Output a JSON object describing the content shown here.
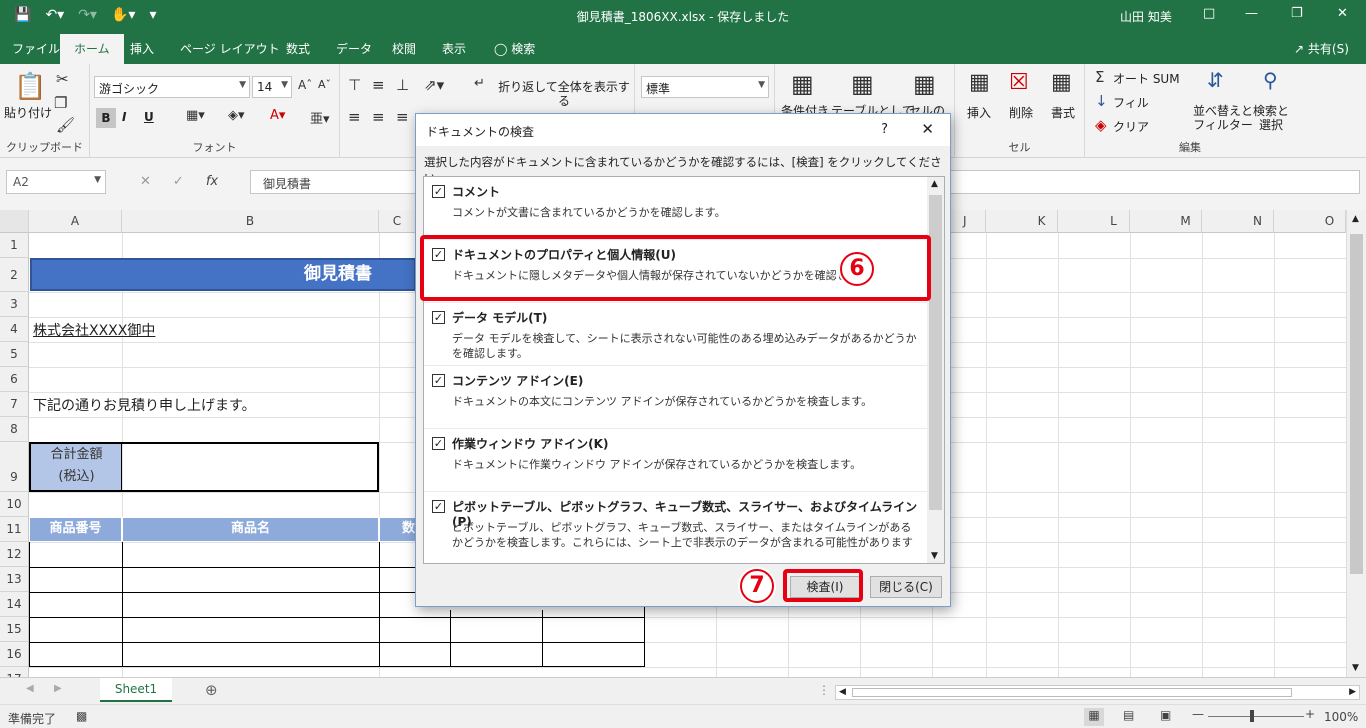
{
  "window": {
    "title": "御見積書_1806XX.xlsx  -  保存しました",
    "user": "山田 知美"
  },
  "tabs": [
    "ファイル",
    "ホーム",
    "挿入",
    "ページ レイアウト",
    "数式",
    "データ",
    "校閲",
    "表示",
    "検索"
  ],
  "tabs_active": "ホーム",
  "share_label": "共有(S)",
  "ribbon": {
    "clipboard": {
      "paste": "貼り付け",
      "group": "クリップボード"
    },
    "font": {
      "name": "游ゴシック",
      "size": "14",
      "bold": "B",
      "italic": "I",
      "underline": "U",
      "group": "フォント"
    },
    "alignment": {
      "wrap": "折り返して全体を表示する"
    },
    "number": {
      "format": "標準"
    },
    "styles": {
      "conditional": "条件付き",
      "table": "テーブルとして",
      "cell": "セルの"
    },
    "cells": {
      "insert": "挿入",
      "delete": "削除",
      "format": "書式",
      "group": "セル"
    },
    "editing": {
      "autosum": "オート SUM",
      "fill": "フィル",
      "clear": "クリア",
      "sort": "並べ替えと\nフィルター",
      "find": "検索と\n選択",
      "group": "編集"
    }
  },
  "formula_bar": {
    "namebox": "A2",
    "content": "御見積書"
  },
  "columns": [
    "A",
    "B",
    "C",
    "J",
    "K",
    "L",
    "M",
    "N",
    "O"
  ],
  "rows": [
    "1",
    "2",
    "3",
    "4",
    "5",
    "6",
    "7",
    "8",
    "9",
    "10",
    "11",
    "12",
    "13",
    "14",
    "15",
    "16",
    "17"
  ],
  "sheet": {
    "banner": "御見積書",
    "customer": "株式会社XXXX御中",
    "greeting": "下記の通りお見積り申し上げます。",
    "total_label_1": "合計金額",
    "total_label_2": "(税込)",
    "col_product_no": "商品番号",
    "col_product_name": "商品名",
    "col_qty": "数"
  },
  "sheet_tab": "Sheet1",
  "status": {
    "ready": "準備完了",
    "zoom": "100%"
  },
  "dialog": {
    "title": "ドキュメントの検査",
    "help": "?",
    "intro": "選択した内容がドキュメントに含まれているかどうかを確認するには、[検査] をクリックしてください。",
    "items": [
      {
        "name": "コメント",
        "desc": "コメントが文書に含まれているかどうかを確認します。",
        "checked": true
      },
      {
        "name": "ドキュメントのプロパティと個人情報(U)",
        "desc": "ドキュメントに隠しメタデータや個人情報が保存されていないかどうかを確認します。",
        "checked": true
      },
      {
        "name": "データ モデル(T)",
        "desc": "データ モデルを検査して、シートに表示されない可能性のある埋め込みデータがあるかどうかを確認します。",
        "checked": true
      },
      {
        "name": "コンテンツ アドイン(E)",
        "desc": "ドキュメントの本文にコンテンツ アドインが保存されているかどうかを検査します。",
        "checked": true
      },
      {
        "name": "作業ウィンドウ アドイン(K)",
        "desc": "ドキュメントに作業ウィンドウ アドインが保存されているかどうかを検査します。",
        "checked": true
      },
      {
        "name": "ピボットテーブル、ピボットグラフ、キューブ数式、スライサー、およびタイムライン(P)",
        "desc": "ピボットテーブル、ピボットグラフ、キューブ数式、スライサー、またはタイムラインがあるかどうかを検査します。これらには、シート上で非表示のデータが含まれる可能性があります",
        "checked": true
      }
    ],
    "inspect_button": "検査(I)",
    "close_button": "閉じる(C)"
  },
  "annotations": {
    "marker6": "6",
    "marker7": "7"
  },
  "colors": {
    "excel_green": "#217346",
    "banner_blue": "#4472c4",
    "header_blue": "#8eaadb",
    "annotation_red": "#e60012"
  }
}
